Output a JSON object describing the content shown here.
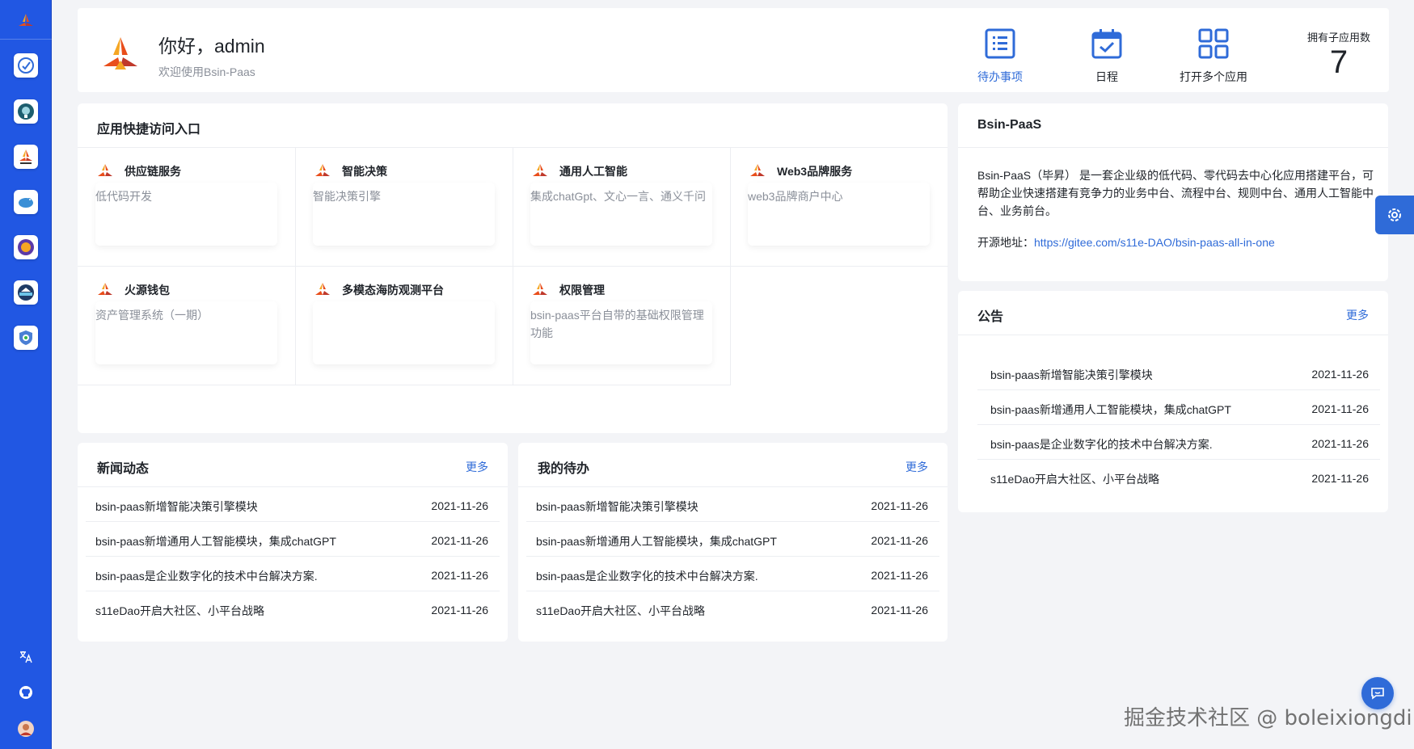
{
  "sidebar": {
    "logo_icon": "bsin-flower-logo",
    "apps": [
      {
        "icon": "decision-app-icon"
      },
      {
        "icon": "ai-brain-app-icon"
      },
      {
        "icon": "paascloud-app-icon"
      },
      {
        "icon": "bird-app-icon"
      },
      {
        "icon": "wallet-orb-app-icon"
      },
      {
        "icon": "ocean-observe-app-icon"
      },
      {
        "icon": "shield-app-icon"
      }
    ],
    "bottom": [
      {
        "icon": "translate-icon",
        "glyph": "文A"
      },
      {
        "icon": "github-icon"
      },
      {
        "icon": "user-avatar"
      }
    ]
  },
  "header": {
    "greeting": "你好，admin",
    "welcome": "欢迎使用Bsin-Paas",
    "actions": [
      {
        "label": "待办事项",
        "icon": "todo-list-icon",
        "active": true
      },
      {
        "label": "日程",
        "icon": "calendar-icon",
        "active": false
      },
      {
        "label": "打开多个应用",
        "icon": "grid-apps-icon",
        "active": false
      }
    ],
    "sub_app_label": "拥有子应用数",
    "sub_app_count": "7"
  },
  "quick_access": {
    "title": "应用快捷访问入口",
    "items": [
      {
        "name": "供应链服务",
        "desc": "低代码开发"
      },
      {
        "name": "智能决策",
        "desc": "智能决策引擎"
      },
      {
        "name": "通用人工智能",
        "desc": "集成chatGpt、文心一言、通义千问"
      },
      {
        "name": "Web3品牌服务",
        "desc": "web3品牌商户中心"
      },
      {
        "name": "火源钱包",
        "desc": "资产管理系统（一期）"
      },
      {
        "name": "多模态海防观测平台",
        "desc": ""
      },
      {
        "name": "权限管理",
        "desc": "bsin-paas平台自带的基础权限管理功能"
      }
    ]
  },
  "about": {
    "title": "Bsin-PaaS",
    "description": "Bsin-PaaS（毕昇） 是一套企业级的低代码、零代码去中心化应用搭建平台，可帮助企业快速搭建有竞争力的业务中台、流程中台、规则中台、通用人工智能中台、业务前台。",
    "source_label": "开源地址：",
    "source_url": "https://gitee.com/s11e-DAO/bsin-paas-all-in-one"
  },
  "notice": {
    "title": "公告",
    "more": "更多",
    "items": [
      {
        "title": "bsin-paas新增智能决策引擎模块",
        "date": "2021-11-26"
      },
      {
        "title": "bsin-paas新增通用人工智能模块，集成chatGPT",
        "date": "2021-11-26"
      },
      {
        "title": "bsin-paas是企业数字化的技术中台解决方案.",
        "date": "2021-11-26"
      },
      {
        "title": "s11eDao开启大社区、小平台战略",
        "date": "2021-11-26"
      }
    ]
  },
  "news": {
    "title": "新闻动态",
    "more": "更多",
    "items": [
      {
        "title": "bsin-paas新增智能决策引擎模块",
        "date": "2021-11-26"
      },
      {
        "title": "bsin-paas新增通用人工智能模块，集成chatGPT",
        "date": "2021-11-26"
      },
      {
        "title": "bsin-paas是企业数字化的技术中台解决方案.",
        "date": "2021-11-26"
      },
      {
        "title": "s11eDao开启大社区、小平台战略",
        "date": "2021-11-26"
      }
    ]
  },
  "todos": {
    "title": "我的待办",
    "more": "更多",
    "items": [
      {
        "title": "bsin-paas新增智能决策引擎模块",
        "date": "2021-11-26"
      },
      {
        "title": "bsin-paas新增通用人工智能模块，集成chatGPT",
        "date": "2021-11-26"
      },
      {
        "title": "bsin-paas是企业数字化的技术中台解决方案.",
        "date": "2021-11-26"
      },
      {
        "title": "s11eDao开启大社区、小平台战略",
        "date": "2021-11-26"
      }
    ]
  },
  "floating": {
    "settings_icon": "gear-icon",
    "chat_icon": "chat-bubble-icon"
  },
  "watermark": "掘金技术社区 @ boleixiongdi",
  "colors": {
    "sidebar": "#2157e3",
    "accent": "#2f6bd8",
    "background": "#f3f4f7"
  }
}
